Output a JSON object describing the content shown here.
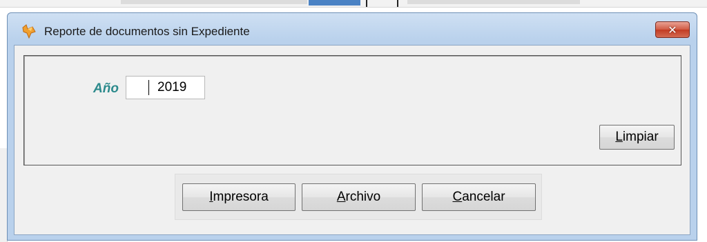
{
  "window": {
    "title": "Reporte de documentos sin Expediente",
    "close_symbol": "✕",
    "app_icon": "fox-app-icon"
  },
  "form": {
    "year_label": "Año",
    "year_value": "2019"
  },
  "buttons": {
    "clear": {
      "mnemonic": "L",
      "rest": "impiar"
    },
    "printer": {
      "mnemonic": "I",
      "rest": "mpresora"
    },
    "file": {
      "mnemonic": "A",
      "rest": "rchivo"
    },
    "cancel": {
      "mnemonic": "C",
      "rest": "ancelar"
    }
  },
  "colors": {
    "titlebar": "#b9d1ec",
    "label_accent": "#2c8a8c",
    "close_button": "#c23b22"
  }
}
